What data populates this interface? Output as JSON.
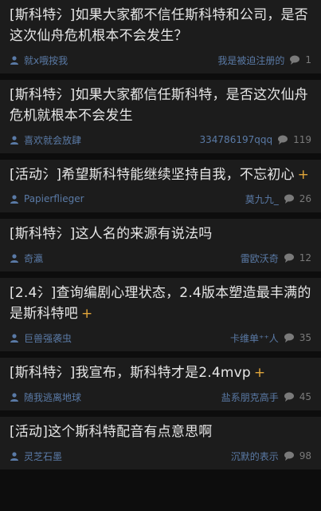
{
  "posts": [
    {
      "title": "[斯科特氵]如果大家都不信任斯科特和公司，是否这次仙舟危机根本不会发生？",
      "plus": "",
      "author": "就x哦按我",
      "last_replier": "我是被迫注册的",
      "replies": "1"
    },
    {
      "title": "[斯科特氵]如果大家都信任斯科特，是否这次仙舟危机就根本不会发生",
      "plus": "",
      "author": "喜欢就会放肆",
      "last_replier": "334786197qqq",
      "replies": "119"
    },
    {
      "title": "[活动氵]希望斯科特能继续坚持自我，不忘初心",
      "plus": "+",
      "author": "Papierflieger",
      "last_replier": "莫九九_",
      "replies": "26"
    },
    {
      "title": "[斯科特氵]这人名的来源有说法吗",
      "plus": "",
      "author": "奇瀛",
      "last_replier": "雷欧沃奇",
      "replies": "12"
    },
    {
      "title": "[2.4氵]查询编剧心理状态，2.4版本塑造最丰满的是斯科特吧",
      "plus": "+",
      "author": "巨兽强袭虫",
      "last_replier": "卡维单⁺⁺人",
      "replies": "35"
    },
    {
      "title": "[斯科特氵]我宣布，斯科特才是2.4mvp",
      "plus": "+",
      "author": "随我逃离地球",
      "last_replier": "盐系朋克高手",
      "replies": "45"
    },
    {
      "title": "[活动]这个斯科特配音有点意思啊",
      "plus": "",
      "author": "灵芝石墨",
      "last_replier": "沉默的表示",
      "replies": "98"
    }
  ],
  "colors": {
    "background": "#0d0d0d",
    "card": "#1c1c1c",
    "title": "#e6e6e6",
    "meta": "#5a7aa6",
    "plus": "#e0a53a"
  },
  "icons": {
    "author": "user-icon",
    "replies": "comment-bubble-icon"
  }
}
